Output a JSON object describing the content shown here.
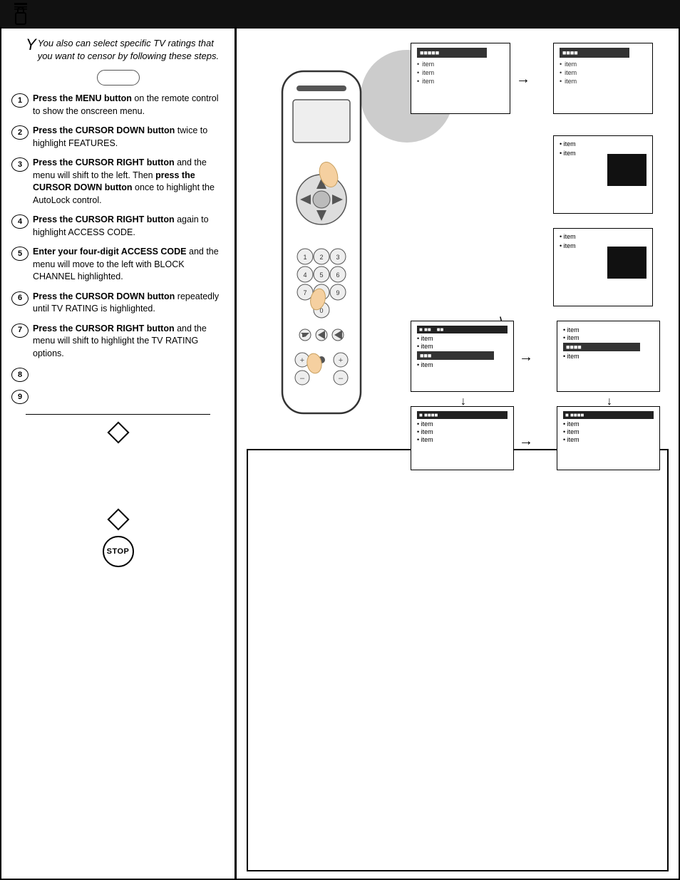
{
  "page": {
    "topbar": {
      "background": "#111"
    },
    "intro": {
      "text": "You also can select specific TV ratings that you want to censor by following these steps."
    },
    "steps": [
      {
        "num": "1",
        "text_bold": "Press the MENU button",
        "text_rest": " on the remote control to show the onscreen menu."
      },
      {
        "num": "2",
        "text_bold": "Press the CURSOR DOWN button",
        "text_rest": " twice to highlight FEATURES."
      },
      {
        "num": "3",
        "text_bold": "Press the CURSOR RIGHT button",
        "text_rest": " and the menu will shift to the left. Then ",
        "text_bold2": "press the CURSOR DOWN button",
        "text_rest2": " once to highlight the AutoLock control."
      },
      {
        "num": "4",
        "text_bold": "Press the CURSOR RIGHT button",
        "text_rest": " again to highlight ACCESS CODE."
      },
      {
        "num": "5",
        "text_bold": "Enter your four-digit ACCESS CODE",
        "text_rest": " and the menu will move to the left with BLOCK CHANNEL highlighted."
      },
      {
        "num": "6",
        "text_bold": "Press the CURSOR DOWN button",
        "text_rest": " repeatedly until TV RATING is highlighted."
      },
      {
        "num": "7",
        "text_bold": "Press the CURSOR RIGHT button",
        "text_rest": " and the menu will shift to highlight the TV RATING options."
      },
      {
        "num": "8",
        "text_bold": "",
        "text_rest": ""
      },
      {
        "num": "9",
        "text_bold": "",
        "text_rest": ""
      }
    ],
    "stop_label": "STOP"
  }
}
